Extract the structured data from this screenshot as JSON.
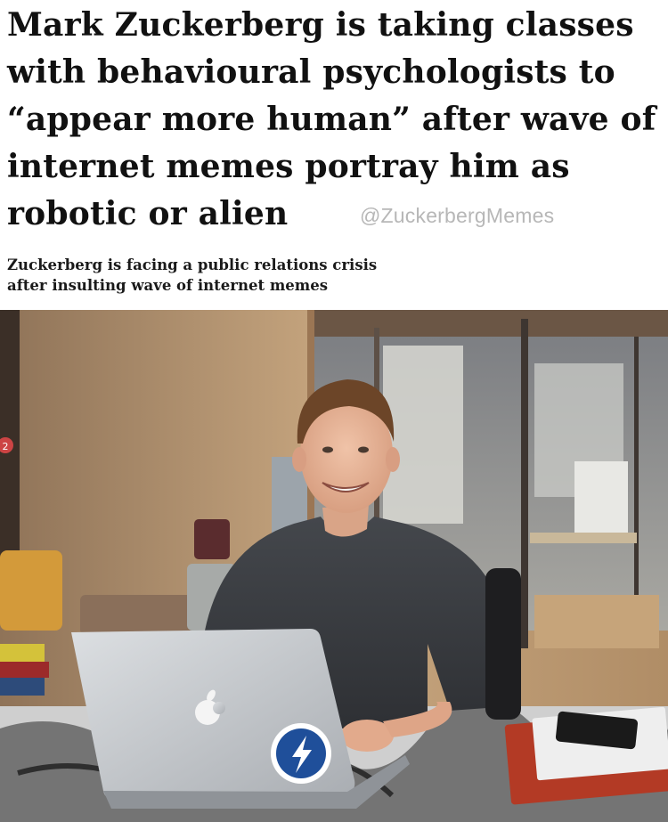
{
  "headline": {
    "lines": [
      "Mark Zuckerberg is taking classes",
      "with behavioural psychologists to",
      "“appear more human” after wave of",
      "internet memes portray him as",
      "robotic or alien"
    ]
  },
  "watermark": "@ZuckerbergMemes",
  "subhead": {
    "lines": [
      "Zuckerberg is facing a public relations crisis",
      "after insulting wave of internet memes"
    ]
  },
  "photo": {
    "sign_number": "2"
  },
  "colors": {
    "text": "#111111",
    "watermark": "#b7b7b7",
    "wall": "#c4a27c",
    "shirt": "#3a3d42",
    "laptop": "#c9ccd0",
    "sticker": "#1f4f9a"
  }
}
